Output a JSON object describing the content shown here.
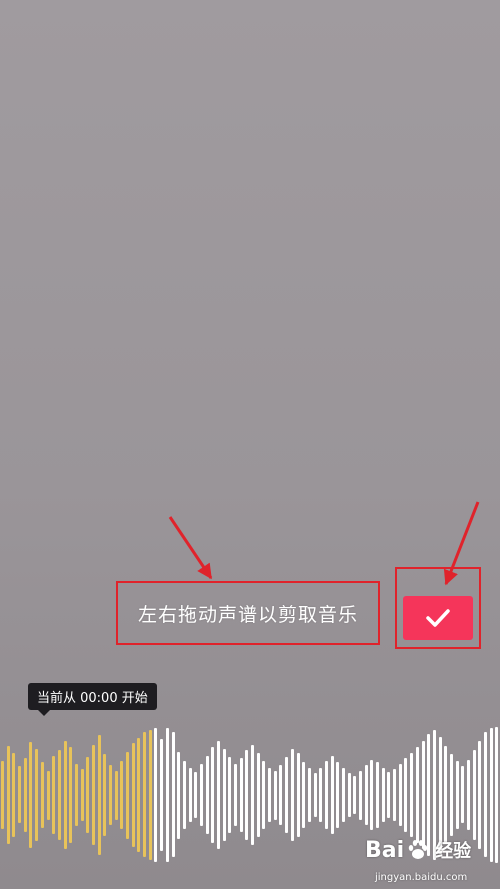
{
  "editor": {
    "hint_text": "左右拖动声谱以剪取音乐",
    "confirm_icon": "check-icon",
    "tooltip_text": "当前从 00:00 开始"
  },
  "waveform": {
    "selected_color": "#e8c35a",
    "unselected_color": "#ffffff",
    "selected_fraction": 0.31,
    "levels": [
      0.5,
      0.72,
      0.62,
      0.42,
      0.55,
      0.78,
      0.68,
      0.48,
      0.36,
      0.58,
      0.66,
      0.8,
      0.7,
      0.46,
      0.38,
      0.56,
      0.74,
      0.88,
      0.6,
      0.44,
      0.36,
      0.5,
      0.64,
      0.76,
      0.84,
      0.92,
      0.95,
      0.98,
      0.82,
      0.98,
      0.92,
      0.64,
      0.5,
      0.4,
      0.34,
      0.46,
      0.58,
      0.7,
      0.8,
      0.68,
      0.56,
      0.46,
      0.54,
      0.66,
      0.74,
      0.62,
      0.5,
      0.4,
      0.36,
      0.44,
      0.56,
      0.68,
      0.62,
      0.48,
      0.4,
      0.32,
      0.4,
      0.5,
      0.58,
      0.48,
      0.4,
      0.32,
      0.28,
      0.36,
      0.44,
      0.52,
      0.48,
      0.4,
      0.34,
      0.38,
      0.46,
      0.54,
      0.62,
      0.7,
      0.8,
      0.9,
      0.96,
      0.86,
      0.72,
      0.6,
      0.5,
      0.42,
      0.52,
      0.66,
      0.8,
      0.92,
      0.98,
      1.0
    ]
  },
  "colors": {
    "accent": "#f5355a",
    "annotation_red": "#e0232b",
    "tooltip_bg": "#1e1d21",
    "background": "#9b969a"
  },
  "watermark": {
    "logo_left": "Bai",
    "logo_right": "经验",
    "paw_icon": "baidu-paw-icon",
    "url": "jingyan.baidu.com"
  }
}
